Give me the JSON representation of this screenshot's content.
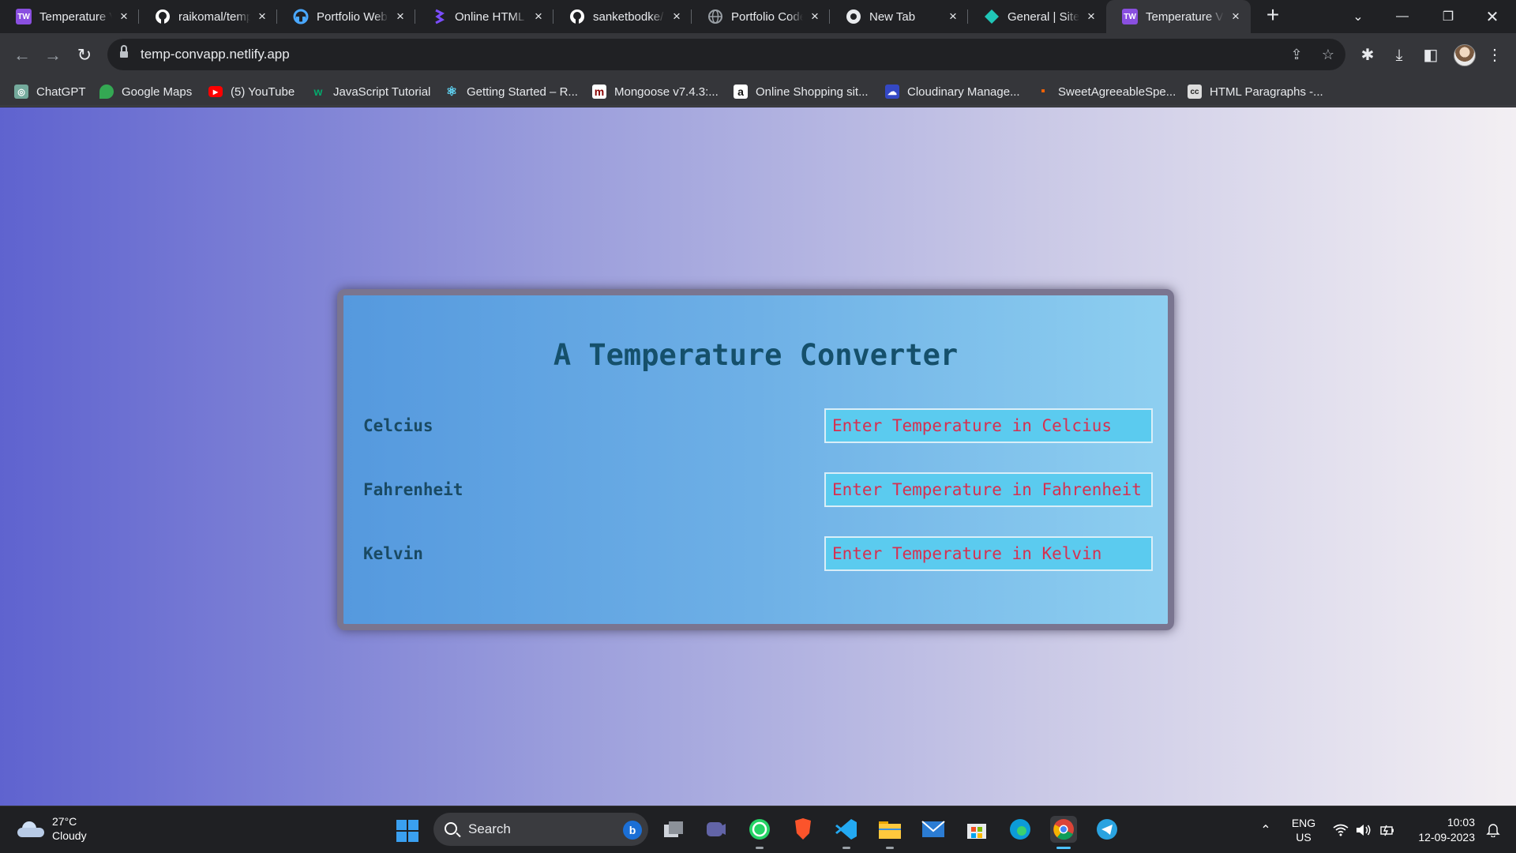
{
  "browser": {
    "tabs": [
      {
        "label": "Temperature V",
        "icon": "tw-icon",
        "active": false
      },
      {
        "label": "raikomal/temp",
        "icon": "github-icon",
        "active": false
      },
      {
        "label": "Portfolio Web",
        "icon": "portfolio-icon",
        "active": false
      },
      {
        "label": "Online HTML I",
        "icon": "html-editor-icon",
        "active": false
      },
      {
        "label": "sanketbodke/",
        "icon": "github-icon",
        "active": false
      },
      {
        "label": "Portfolio Code",
        "icon": "globe-icon",
        "active": false
      },
      {
        "label": "New Tab",
        "icon": "chrome-icon",
        "active": false
      },
      {
        "label": "General | Site",
        "icon": "netlify-icon",
        "active": false
      },
      {
        "label": "Temperature V",
        "icon": "tw-icon",
        "active": true
      }
    ],
    "tw_badge": "TW",
    "url": "temp-convapp.netlify.app",
    "bookmarks": [
      {
        "label": "ChatGPT",
        "color": "#74aa9c",
        "glyph": "◎"
      },
      {
        "label": "Google Maps",
        "color": "#34a853",
        "glyph": "●"
      },
      {
        "label": "(5) YouTube",
        "color": "#ff0000",
        "glyph": "▶"
      },
      {
        "label": "JavaScript Tutorial",
        "color": "#04aa6d",
        "glyph": "w"
      },
      {
        "label": "Getting Started – R...",
        "color": "#61dafb",
        "glyph": "⚛"
      },
      {
        "label": "Mongoose v7.4.3:...",
        "color": "#880000",
        "glyph": "m"
      },
      {
        "label": "Online Shopping sit...",
        "color": "#ffffff",
        "glyph": "a"
      },
      {
        "label": "Cloudinary Manage...",
        "color": "#3448c5",
        "glyph": "☁"
      },
      {
        "label": "SweetAgreeableSpe...",
        "color": "#f26207",
        "glyph": "▪"
      },
      {
        "label": "HTML Paragraphs -...",
        "color": "#dddddd",
        "glyph": "cc"
      }
    ]
  },
  "app": {
    "title": "A Temperature Converter",
    "fields": [
      {
        "label": "Celcius",
        "placeholder": "Enter Temperature in Celcius"
      },
      {
        "label": "Fahrenheit",
        "placeholder": "Enter Temperature in Fahrenheit"
      },
      {
        "label": "Kelvin",
        "placeholder": "Enter Temperature in Kelvin"
      }
    ]
  },
  "taskbar": {
    "weather_temp": "27°C",
    "weather_desc": "Cloudy",
    "search_placeholder": "Search",
    "bing_glyph": "b",
    "language": "ENG",
    "region": "US",
    "time": "10:03",
    "date": "12-09-2023"
  },
  "colors": {
    "title": "#15506b",
    "label": "#1a4a63",
    "input_bg": "#5bcbef",
    "input_text": "#d63050"
  }
}
